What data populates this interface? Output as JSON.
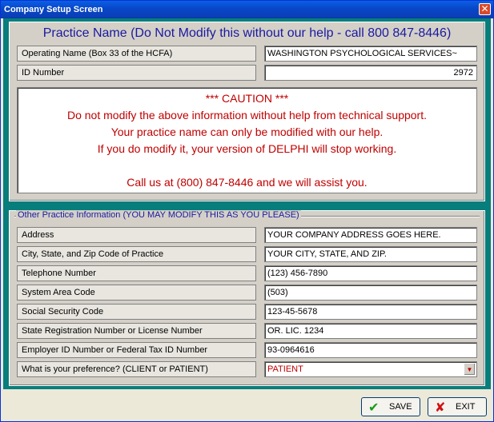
{
  "window": {
    "title": "Company Setup Screen",
    "close_glyph": "✕"
  },
  "practice": {
    "heading": "Practice Name (Do Not Modify this without our help - call 800 847-8446)",
    "fields": [
      {
        "label": "Operating Name (Box 33 of the HCFA)",
        "value": "WASHINGTON PSYCHOLOGICAL SERVICES~"
      },
      {
        "label": "ID Number",
        "value": "2972"
      }
    ]
  },
  "caution": {
    "lines": [
      "*** CAUTION ***",
      "Do not modify the above information without help from technical support.",
      "Your practice name can only be modified with our help.",
      "If you do modify it, your version of DELPHI will stop working.",
      "",
      "Call us at (800) 847-8446 and we will assist you."
    ]
  },
  "other": {
    "caption": "Other Practice Information (YOU MAY MODIFY THIS AS YOU PLEASE)",
    "fields": [
      {
        "label": "Address",
        "value": "YOUR COMPANY ADDRESS GOES HERE."
      },
      {
        "label": "City, State, and Zip Code of Practice",
        "value": "YOUR CITY, STATE, AND ZIP."
      },
      {
        "label": "Telephone Number",
        "value": "(123) 456-7890"
      },
      {
        "label": "System Area Code",
        "value": "(503)"
      },
      {
        "label": "Social Security Code",
        "value": "123-45-5678"
      },
      {
        "label": "State Registration Number or License Number",
        "value": "OR. LIC. 1234"
      },
      {
        "label": "Employer ID Number or Federal Tax ID Number",
        "value": "93-0964616"
      },
      {
        "label": "What is your preference? (CLIENT or PATIENT)",
        "value": "PATIENT"
      }
    ]
  },
  "buttons": {
    "save_label": "SAVE",
    "exit_label": "EXIT",
    "save_glyph": "✔",
    "exit_glyph": "✘",
    "dropdown_glyph": "▼"
  },
  "colors": {
    "teal": "#077e7c",
    "caution_red": "#c00000",
    "heading_blue": "#1a1aa0",
    "title_blue": "#0846c8"
  }
}
